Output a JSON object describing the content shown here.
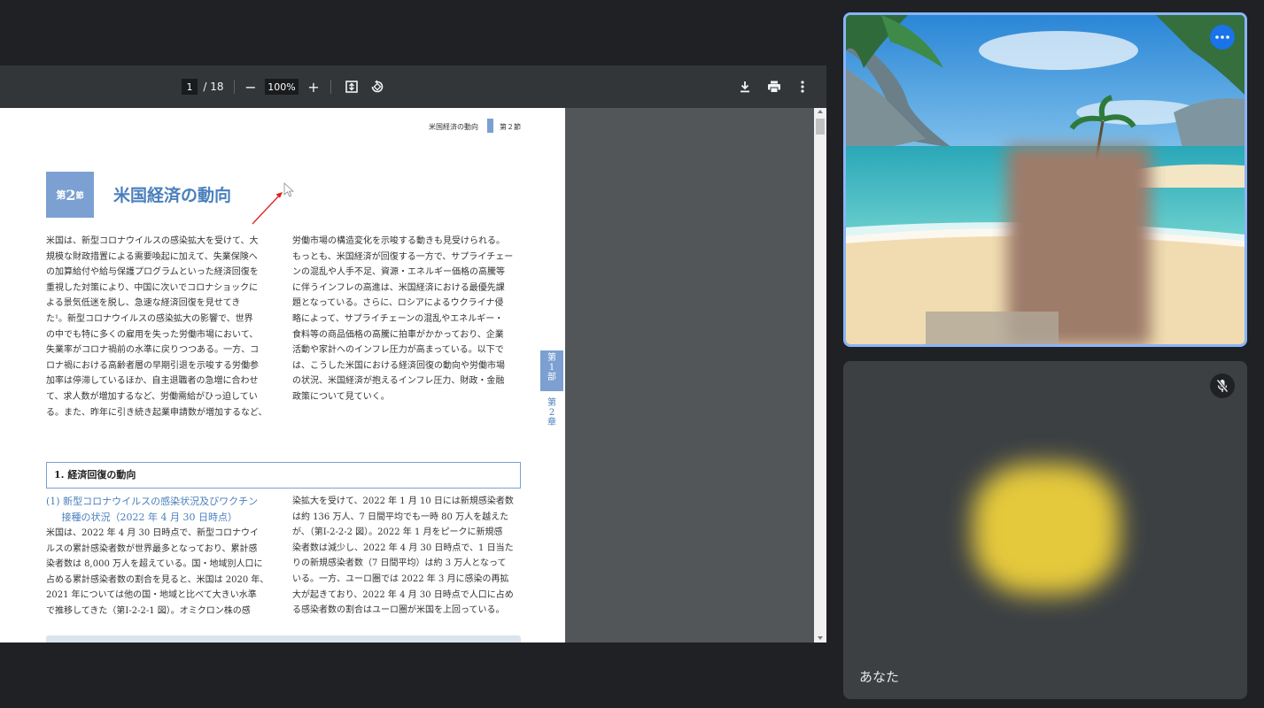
{
  "pdf_viewer": {
    "current_page": "1",
    "total_pages": "/ 18",
    "zoom_out": "−",
    "zoom": "100%",
    "zoom_in": "+"
  },
  "document": {
    "running_header": "米国経済の動向",
    "running_section": "第２節",
    "section_badge_pre": "第",
    "section_badge_num": "2",
    "section_badge_post": "節",
    "section_title": "米国経済の動向",
    "intro_left": [
      "米国は、新型コロナウイルスの感染拡大を受けて、大",
      "規模な財政措置による需要喚起に加えて、失業保険へ",
      "の加算給付や給与保護プログラムといった経済回復を",
      "重視した対策により、中国に次いでコロナショックに",
      "よる景気低迷を脱し、急速な経済回復を見せてき",
      "た¹。新型コロナウイルスの感染拡大の影響で、世界",
      "の中でも特に多くの雇用を失った労働市場において、",
      "失業率がコロナ禍前の水準に戻りつつある。一方、コ",
      "ロナ禍における高齢者層の早期引退を示唆する労働参",
      "加率は停滞しているほか、自主退職者の急増に合わせ",
      "て、求人数が増加するなど、労働需給がひっ迫してい",
      "る。また、昨年に引き続き起業申請数が増加するなど、"
    ],
    "intro_right": [
      "労働市場の構造変化を示唆する動きも見受けられる。",
      "もっとも、米国経済が回復する一方で、サプライチェー",
      "ンの混乱や人手不足、資源・エネルギー価格の高騰等",
      "に伴うインフレの高進は、米国経済における最優先課",
      "題となっている。さらに、ロシアによるウクライナ侵",
      "略によって、サプライチェーンの混乱やエネルギー・",
      "食料等の商品価格の高騰に拍車がかかっており、企業",
      "活動や家計へのインフレ圧力が高まっている。以下で",
      "は、こうした米国における経済回復の動向や労働市場",
      "の状況、米国経済が抱えるインフレ圧力、財政・金融",
      "政策について見ていく。"
    ],
    "side_tab_1": "第\n1\n部",
    "side_tab_2": "第\n2\n章",
    "heading_1": "1.  経済回復の動向",
    "subheading_line1": "(1) 新型コロナウイルスの感染状況及びワクチン",
    "subheading_line2": "     接種の状況（2022 年 4 月 30 日時点）",
    "body_left": [
      "米国は、2022 年 4 月 30 日時点で、新型コロナウイ",
      "ルスの累計感染者数が世界最多となっており、累計感",
      "染者数は 8,000 万人を超えている。国・地域別人口に",
      "占める累計感染者数の割合を見ると、米国は 2020 年、",
      "2021 年については他の国・地域と比べて大きい水準",
      "で推移してきた（第Ⅰ-2-2-1 図）。オミクロン株の感"
    ],
    "body_right": [
      "染拡大を受けて、2022 年 1 月 10 日には新規感染者数",
      "は約 136 万人、7 日間平均でも一時 80 万人を越えた",
      "が、（第Ⅰ-2-2-2 図）。2022 年 1 月をピークに新規感",
      "染者数は減少し、2022 年 4 月 30 日時点で、1 日当た",
      "りの新規感染者数（7 日間平均）は約 3 万人となって",
      "いる。一方、ユーロ圏では 2022 年 3 月に感染の再拡",
      "大が起きており、2022 年 4 月 30 日時点で人口に占め",
      "る感染者数の割合はユーロ圏が米国を上回っている。"
    ]
  },
  "participants": {
    "self_name": "あなた"
  },
  "colors": {
    "accent_blue": "#1a73e8",
    "tile_border": "#8ab4f8",
    "doc_blue": "#7ba0d1"
  }
}
